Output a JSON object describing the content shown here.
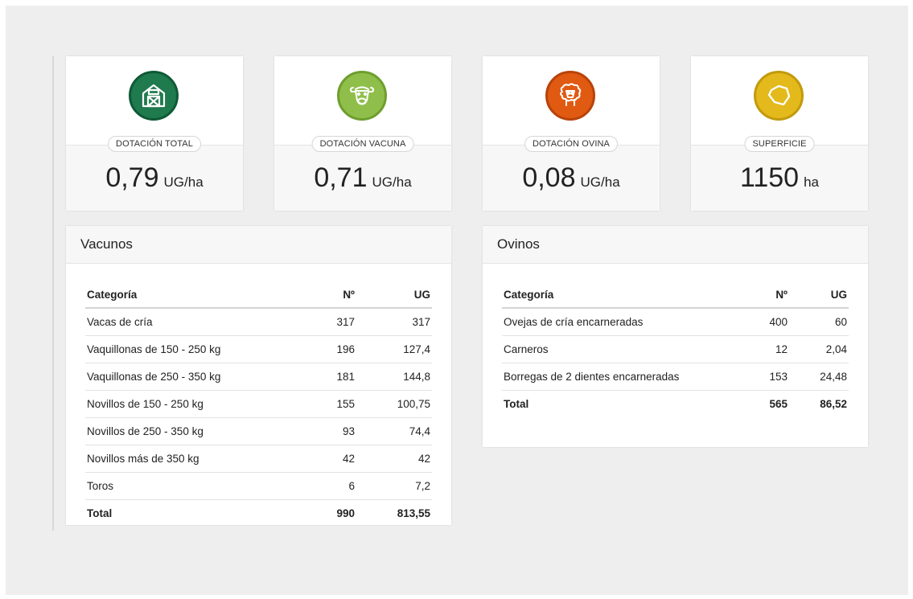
{
  "stats": [
    {
      "label": "DOTACIÓN TOTAL",
      "value": "0,79",
      "unit": "UG/ha",
      "icon": "barn-icon",
      "color": "#1f7a4d"
    },
    {
      "label": "DOTACIÓN VACUNA",
      "value": "0,71",
      "unit": "UG/ha",
      "icon": "cow-icon",
      "color": "#8fbf4a"
    },
    {
      "label": "DOTACIÓN OVINA",
      "value": "0,08",
      "unit": "UG/ha",
      "icon": "sheep-icon",
      "color": "#e05a12"
    },
    {
      "label": "SUPERFICIE",
      "value": "1150",
      "unit": "ha",
      "icon": "land-parcel-icon",
      "color": "#e3b91c"
    }
  ],
  "vacunos": {
    "title": "Vacunos",
    "headers": {
      "category": "Categoría",
      "n": "Nº",
      "ug": "UG"
    },
    "rows": [
      {
        "category": "Vacas de cría",
        "n": "317",
        "ug": "317"
      },
      {
        "category": "Vaquillonas de 150 - 250 kg",
        "n": "196",
        "ug": "127,4"
      },
      {
        "category": "Vaquillonas de 250 - 350 kg",
        "n": "181",
        "ug": "144,8"
      },
      {
        "category": "Novillos de 150 - 250 kg",
        "n": "155",
        "ug": "100,75"
      },
      {
        "category": "Novillos de 250 - 350 kg",
        "n": "93",
        "ug": "74,4"
      },
      {
        "category": "Novillos más de 350 kg",
        "n": "42",
        "ug": "42"
      },
      {
        "category": "Toros",
        "n": "6",
        "ug": "7,2"
      }
    ],
    "total": {
      "category": "Total",
      "n": "990",
      "ug": "813,55"
    }
  },
  "ovinos": {
    "title": "Ovinos",
    "headers": {
      "category": "Categoría",
      "n": "Nº",
      "ug": "UG"
    },
    "rows": [
      {
        "category": "Ovejas de cría encarneradas",
        "n": "400",
        "ug": "60"
      },
      {
        "category": "Carneros",
        "n": "12",
        "ug": "2,04"
      },
      {
        "category": "Borregas de 2 dientes encarneradas",
        "n": "153",
        "ug": "24,48"
      }
    ],
    "total": {
      "category": "Total",
      "n": "565",
      "ug": "86,52"
    }
  }
}
